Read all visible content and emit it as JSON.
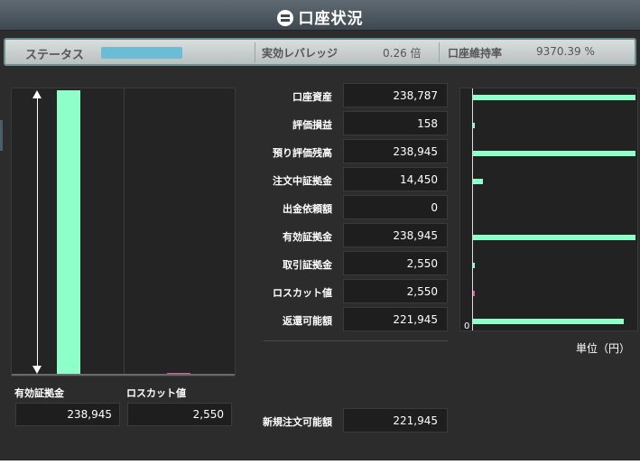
{
  "window": {
    "title": "口座状況",
    "title_icon": "account-status-icon"
  },
  "status": {
    "label": "ステータス",
    "gauge_fraction": 0.83,
    "leverage_label": "実効レバレッジ",
    "leverage_value": "0.26 倍",
    "maintenance_label": "口座維持率",
    "maintenance_value": "9370.39 %"
  },
  "left_chart": {
    "bars": [
      {
        "name": "有効証拠金",
        "value": 238945,
        "color": "#8effc8"
      },
      {
        "name": "ロスカット値",
        "value": 2550,
        "color": "#e0579d"
      }
    ],
    "max": 238945
  },
  "left_values": {
    "margin_label": "有効証拠金",
    "margin_value": "238,945",
    "losscut_label": "ロスカット値",
    "losscut_value": "2,550"
  },
  "rows": [
    {
      "label": "口座資産",
      "value": "238,787",
      "num": 238787,
      "color": "#8effc8"
    },
    {
      "label": "評価損益",
      "value": "158",
      "num": 158,
      "color": "#8effc8"
    },
    {
      "label": "預り評価残高",
      "value": "238,945",
      "num": 238945,
      "color": "#8effc8"
    },
    {
      "label": "注文中証拠金",
      "value": "14,450",
      "num": 14450,
      "color": "#8effc8"
    },
    {
      "label": "出金依頼額",
      "value": "0",
      "num": 0,
      "color": "#8effc8"
    },
    {
      "label": "有効証拠金",
      "value": "238,945",
      "num": 238945,
      "color": "#8effc8"
    },
    {
      "label": "取引証拠金",
      "value": "2,550",
      "num": 2550,
      "color": "#8effc8"
    },
    {
      "label": "ロスカット値",
      "value": "2,550",
      "num": 2550,
      "color": "#e0579d"
    },
    {
      "label": "返還可能額",
      "value": "221,945",
      "num": 221945,
      "color": "#8effc8"
    }
  ],
  "new_order": {
    "label": "新規注文可能額",
    "value": "221,945"
  },
  "right_chart": {
    "zero_label": "0",
    "unit_label": "単位（円）",
    "max": 238945
  }
}
